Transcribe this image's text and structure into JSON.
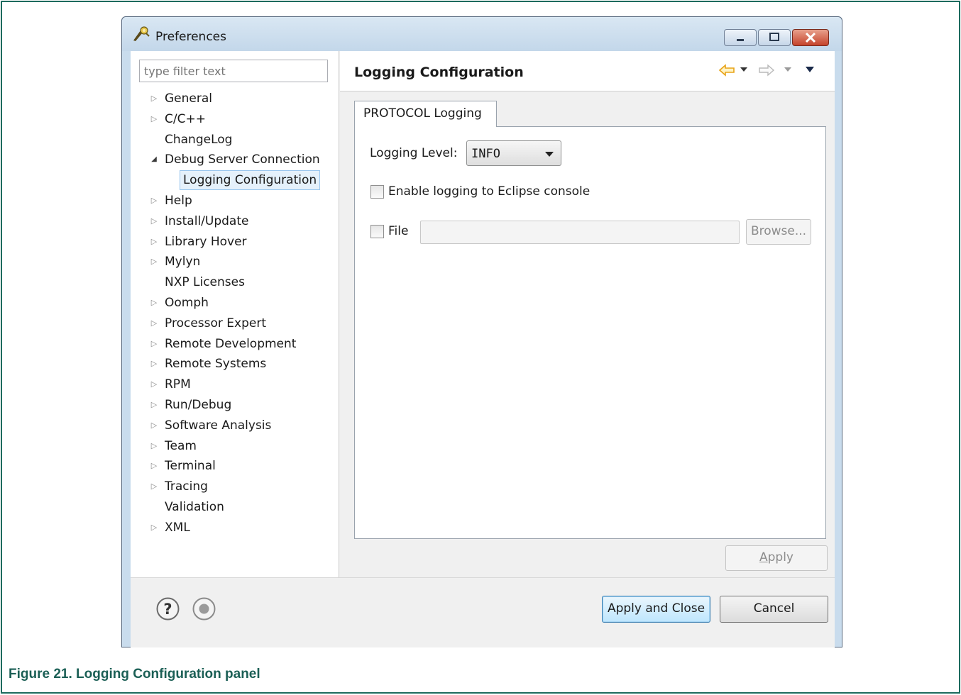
{
  "caption": "Figure 21. Logging Configuration panel",
  "window": {
    "title": "Preferences",
    "controls": {
      "minimize": "minimize",
      "maximize": "maximize",
      "close": "close"
    }
  },
  "filter": {
    "placeholder": "type filter text"
  },
  "tree": [
    {
      "label": "General",
      "expandable": true,
      "expanded": false
    },
    {
      "label": "C/C++",
      "expandable": true,
      "expanded": false
    },
    {
      "label": "ChangeLog",
      "expandable": false
    },
    {
      "label": "Debug Server Connection",
      "expandable": true,
      "expanded": true
    },
    {
      "label": "Logging Configuration",
      "expandable": false,
      "child": true,
      "selected": true
    },
    {
      "label": "Help",
      "expandable": true,
      "expanded": false
    },
    {
      "label": "Install/Update",
      "expandable": true,
      "expanded": false
    },
    {
      "label": "Library Hover",
      "expandable": true,
      "expanded": false
    },
    {
      "label": "Mylyn",
      "expandable": true,
      "expanded": false
    },
    {
      "label": "NXP Licenses",
      "expandable": false
    },
    {
      "label": "Oomph",
      "expandable": true,
      "expanded": false
    },
    {
      "label": "Processor Expert",
      "expandable": true,
      "expanded": false
    },
    {
      "label": "Remote Development",
      "expandable": true,
      "expanded": false
    },
    {
      "label": "Remote Systems",
      "expandable": true,
      "expanded": false
    },
    {
      "label": "RPM",
      "expandable": true,
      "expanded": false
    },
    {
      "label": "Run/Debug",
      "expandable": true,
      "expanded": false
    },
    {
      "label": "Software Analysis",
      "expandable": true,
      "expanded": false
    },
    {
      "label": "Team",
      "expandable": true,
      "expanded": false
    },
    {
      "label": "Terminal",
      "expandable": true,
      "expanded": false
    },
    {
      "label": "Tracing",
      "expandable": true,
      "expanded": false
    },
    {
      "label": "Validation",
      "expandable": false
    },
    {
      "label": "XML",
      "expandable": true,
      "expanded": false
    }
  ],
  "page": {
    "title": "Logging Configuration",
    "tab_label": "PROTOCOL Logging",
    "logging_level_label": "Logging Level:",
    "logging_level_value": "INFO",
    "enable_console_label": "Enable logging to Eclipse console",
    "enable_console_checked": false,
    "file_label": "File",
    "file_checked": false,
    "file_value": "",
    "browse_label": "Browse...",
    "apply_label": "Apply"
  },
  "footer": {
    "apply_close_label": "Apply and Close",
    "cancel_label": "Cancel"
  },
  "colors": {
    "caption": "#1b5f55",
    "frame": "#1d6b5e",
    "selection": "#e5f1fb",
    "back_arrow": "#e8a317"
  }
}
